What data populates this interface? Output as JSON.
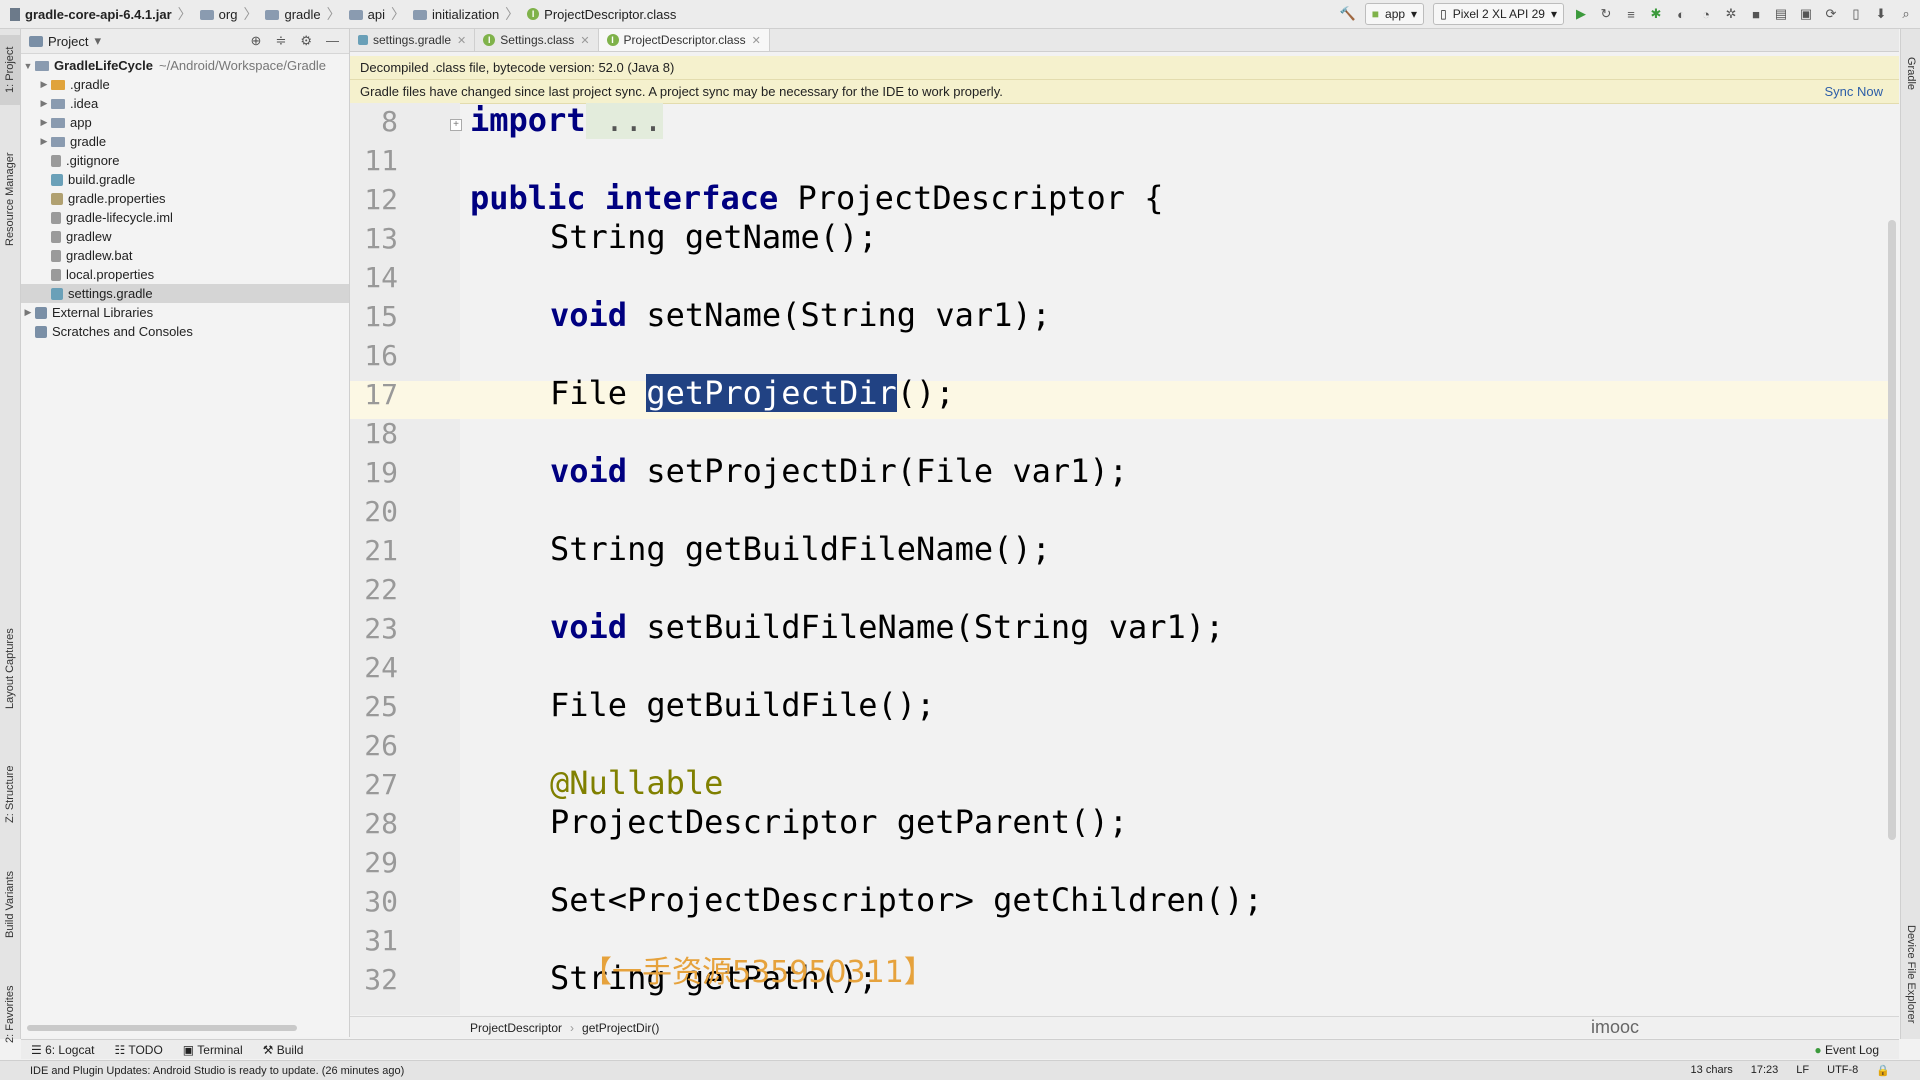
{
  "breadcrumb": [
    "gradle-core-api-6.4.1.jar",
    "org",
    "gradle",
    "api",
    "initialization",
    "ProjectDescriptor.class"
  ],
  "toolbar": {
    "run_config": "app",
    "device": "Pixel 2 XL API 29"
  },
  "project_panel": {
    "title": "Project",
    "root_name": "GradleLifeCycle",
    "root_path": "~/Android/Workspace/Gradle",
    "items": [
      {
        "label": ".gradle"
      },
      {
        "label": ".idea"
      },
      {
        "label": "app"
      },
      {
        "label": "gradle"
      },
      {
        "label": ".gitignore"
      },
      {
        "label": "build.gradle"
      },
      {
        "label": "gradle.properties"
      },
      {
        "label": "gradle-lifecycle.iml"
      },
      {
        "label": "gradlew"
      },
      {
        "label": "gradlew.bat"
      },
      {
        "label": "local.properties"
      },
      {
        "label": "settings.gradle"
      }
    ],
    "external_libraries": "External Libraries",
    "scratches": "Scratches and Consoles"
  },
  "editor_tabs": [
    "settings.gradle",
    "Settings.class",
    "ProjectDescriptor.class"
  ],
  "banners": {
    "decompiled": "Decompiled .class file, bytecode version: 52.0 (Java 8)",
    "sync_message": "Gradle files have changed since last project sync. A project sync may be necessary for the IDE to work properly.",
    "sync_now": "Sync Now"
  },
  "code": {
    "line_numbers": [
      "8",
      "11",
      "12",
      "13",
      "14",
      "15",
      "16",
      "17",
      "18",
      "19",
      "20",
      "21",
      "22",
      "23",
      "24",
      "25",
      "26",
      "27",
      "28",
      "29",
      "30",
      "31",
      "32"
    ],
    "l8_kw": "import",
    "l8_rest": " ...",
    "l12_kw1": "public",
    "l12_kw2": "interface",
    "l12_rest": " ProjectDescriptor {",
    "l13": "String getName();",
    "l15_kw": "void",
    "l15_rest": " setName(String var1);",
    "l17_pre": "File ",
    "l17_sel": "getProjectDir",
    "l17_post": "();",
    "l19_kw": "void",
    "l19_rest": " setProjectDir(File var1);",
    "l21": "String getBuildFileName();",
    "l23_kw": "void",
    "l23_rest": " setBuildFileName(String var1);",
    "l25": "File getBuildFile();",
    "l27": "@Nullable",
    "l28": "ProjectDescriptor getParent();",
    "l30": "Set<ProjectDescriptor> getChildren();",
    "l32": "String getPath();"
  },
  "editor_breadcrumb": [
    "ProjectDescriptor",
    "getProjectDir()"
  ],
  "watermarks": {
    "imooc": "imooc",
    "resource": "【一手资源535950311】"
  },
  "tool_windows": [
    "6: Logcat",
    "TODO",
    "Terminal",
    "Build"
  ],
  "left_tabs": [
    "1: Project",
    "Resource Manager",
    "Layout Captures",
    "Z: Structure",
    "Build Variants",
    "2: Favorites"
  ],
  "right_tabs": [
    "Gradle",
    "Device File Explorer"
  ],
  "status": {
    "message": "IDE and Plugin Updates: Android Studio is ready to update. (26 minutes ago)",
    "chars": "13 chars",
    "position": "17:23",
    "line_sep": "LF",
    "encoding": "UTF-8",
    "event_log": "Event Log"
  }
}
